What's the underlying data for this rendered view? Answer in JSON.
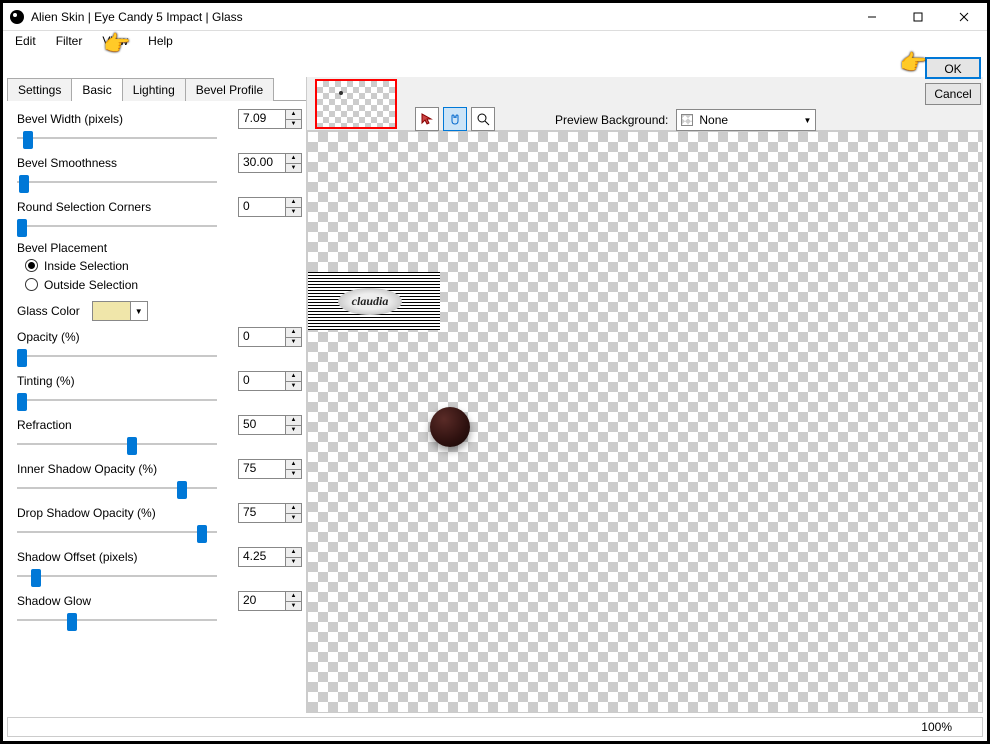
{
  "window": {
    "title": "Alien Skin | Eye Candy 5 Impact | Glass"
  },
  "menu": {
    "edit": "Edit",
    "filter": "Filter",
    "view": "View",
    "help": "Help"
  },
  "tabs": {
    "settings": "Settings",
    "basic": "Basic",
    "lighting": "Lighting",
    "bevel": "Bevel Profile"
  },
  "labels": {
    "bevelWidth": "Bevel Width (pixels)",
    "bevelSmooth": "Bevel Smoothness",
    "roundCorners": "Round Selection Corners",
    "bevelPlacement": "Bevel Placement",
    "inside": "Inside Selection",
    "outside": "Outside Selection",
    "glassColor": "Glass Color",
    "opacity": "Opacity (%)",
    "tinting": "Tinting (%)",
    "refraction": "Refraction",
    "innerShadow": "Inner Shadow Opacity (%)",
    "dropShadow": "Drop Shadow Opacity (%)",
    "shadowOffset": "Shadow Offset (pixels)",
    "shadowGlow": "Shadow Glow",
    "previewBg": "Preview Background:"
  },
  "values": {
    "bevelWidth": "7.09",
    "bevelSmooth": "30.00",
    "roundCorners": "0",
    "opacity": "0",
    "tinting": "0",
    "refraction": "50",
    "innerShadow": "75",
    "dropShadow": "75",
    "shadowOffset": "4.25",
    "shadowGlow": "20",
    "previewBg": "None"
  },
  "thumb_pos": {
    "bevelWidth": 6,
    "bevelSmooth": 2,
    "roundCorners": 0,
    "opacity": 0,
    "tinting": 0,
    "refraction": 110,
    "innerShadow": 160,
    "dropShadow": 180,
    "shadowOffset": 14,
    "shadowGlow": 50
  },
  "buttons": {
    "ok": "OK",
    "cancel": "Cancel"
  },
  "status": {
    "zoom": "100%"
  },
  "watermark": "claudia"
}
